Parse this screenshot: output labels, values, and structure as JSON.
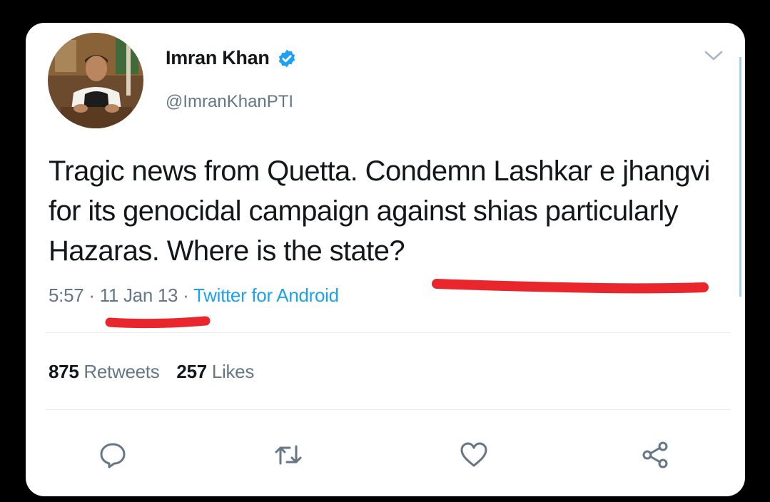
{
  "tweet": {
    "author_name": "Imran Khan",
    "author_handle": "@ImranKhanPTI",
    "text": "Tragic news from Quetta. Condemn Lashkar e jhangvi for its genocidal campaign against shias particularly Hazaras. Where is the state?",
    "time": "5:57",
    "separator": "·",
    "date": "11 Jan 13",
    "source": "Twitter for Android",
    "retweets_count": "875",
    "retweets_label": "Retweets",
    "likes_count": "257",
    "likes_label": "Likes"
  },
  "icons": {
    "verified": "verified-badge-icon",
    "more": "chevron-down-icon",
    "reply": "reply-icon",
    "retweet": "retweet-icon",
    "like": "heart-icon",
    "share": "share-icon"
  },
  "colors": {
    "background": "#000000",
    "card": "#ffffff",
    "text_primary": "#14171a",
    "text_secondary": "#657786",
    "accent": "#1da1f2",
    "highlight_mark": "#e8262b"
  }
}
